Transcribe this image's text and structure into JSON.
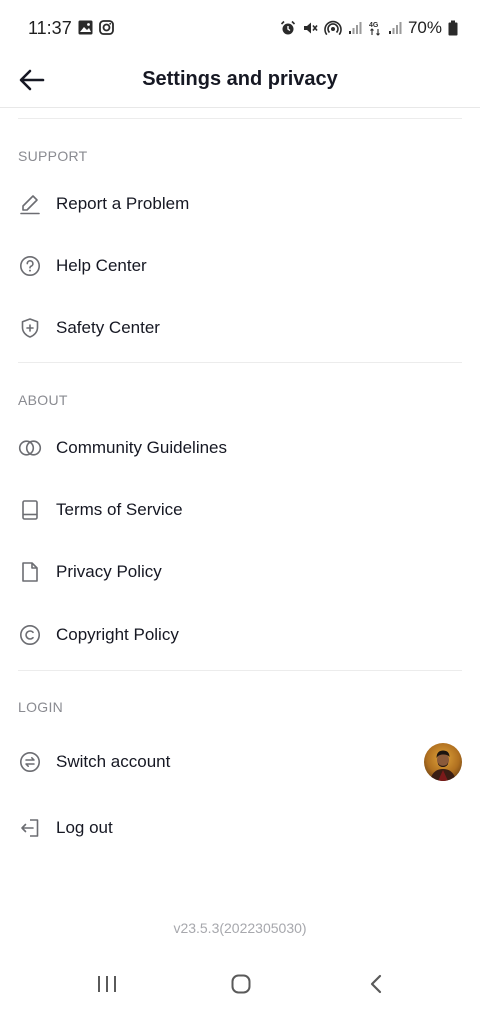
{
  "status_bar": {
    "time": "11:37",
    "battery": "70%",
    "icons": [
      "gallery-icon",
      "instagram-icon",
      "alarm-icon",
      "mute-icon",
      "hotspot-icon",
      "signal-icon",
      "4g-icon",
      "signal-icon",
      "battery-icon"
    ]
  },
  "header": {
    "title": "Settings and privacy",
    "back_icon": "arrow-left-icon"
  },
  "sections": {
    "support": {
      "title": "SUPPORT",
      "items": [
        {
          "label": "Report a Problem",
          "icon": "pencil-icon"
        },
        {
          "label": "Help Center",
          "icon": "question-circle-icon"
        },
        {
          "label": "Safety Center",
          "icon": "shield-plus-icon"
        }
      ]
    },
    "about": {
      "title": "ABOUT",
      "items": [
        {
          "label": "Community Guidelines",
          "icon": "interlocking-circles-icon"
        },
        {
          "label": "Terms of Service",
          "icon": "book-icon"
        },
        {
          "label": "Privacy Policy",
          "icon": "document-icon"
        },
        {
          "label": "Copyright Policy",
          "icon": "copyright-icon"
        }
      ]
    },
    "login": {
      "title": "LOGIN",
      "items": [
        {
          "label": "Switch account",
          "icon": "switch-arrows-icon"
        },
        {
          "label": "Log out",
          "icon": "logout-icon"
        }
      ]
    }
  },
  "version": "v23.5.3(2022305030)",
  "colors": {
    "text": "#161823",
    "muted": "#8a8b91",
    "icon": "#6c6d72",
    "divider": "#ececec"
  }
}
